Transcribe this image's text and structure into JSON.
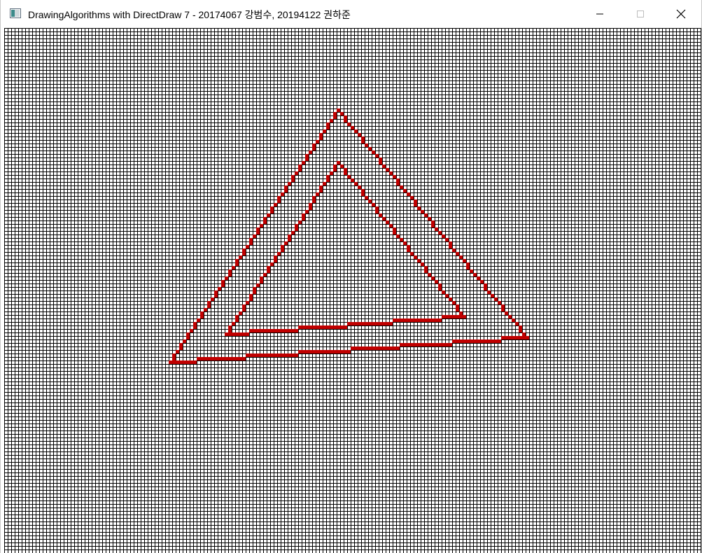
{
  "window": {
    "title": "DrawingAlgorithms with DirectDraw 7 - 20174067 강범수, 20194122 권하준"
  },
  "title_buttons": {
    "minimize_icon": "minimize-icon",
    "maximize_icon": "maximize-icon",
    "close_icon": "close-icon"
  },
  "canvas": {
    "grid_color": "#000000",
    "pixel_color": "#c00000",
    "background": "#ffffff"
  }
}
